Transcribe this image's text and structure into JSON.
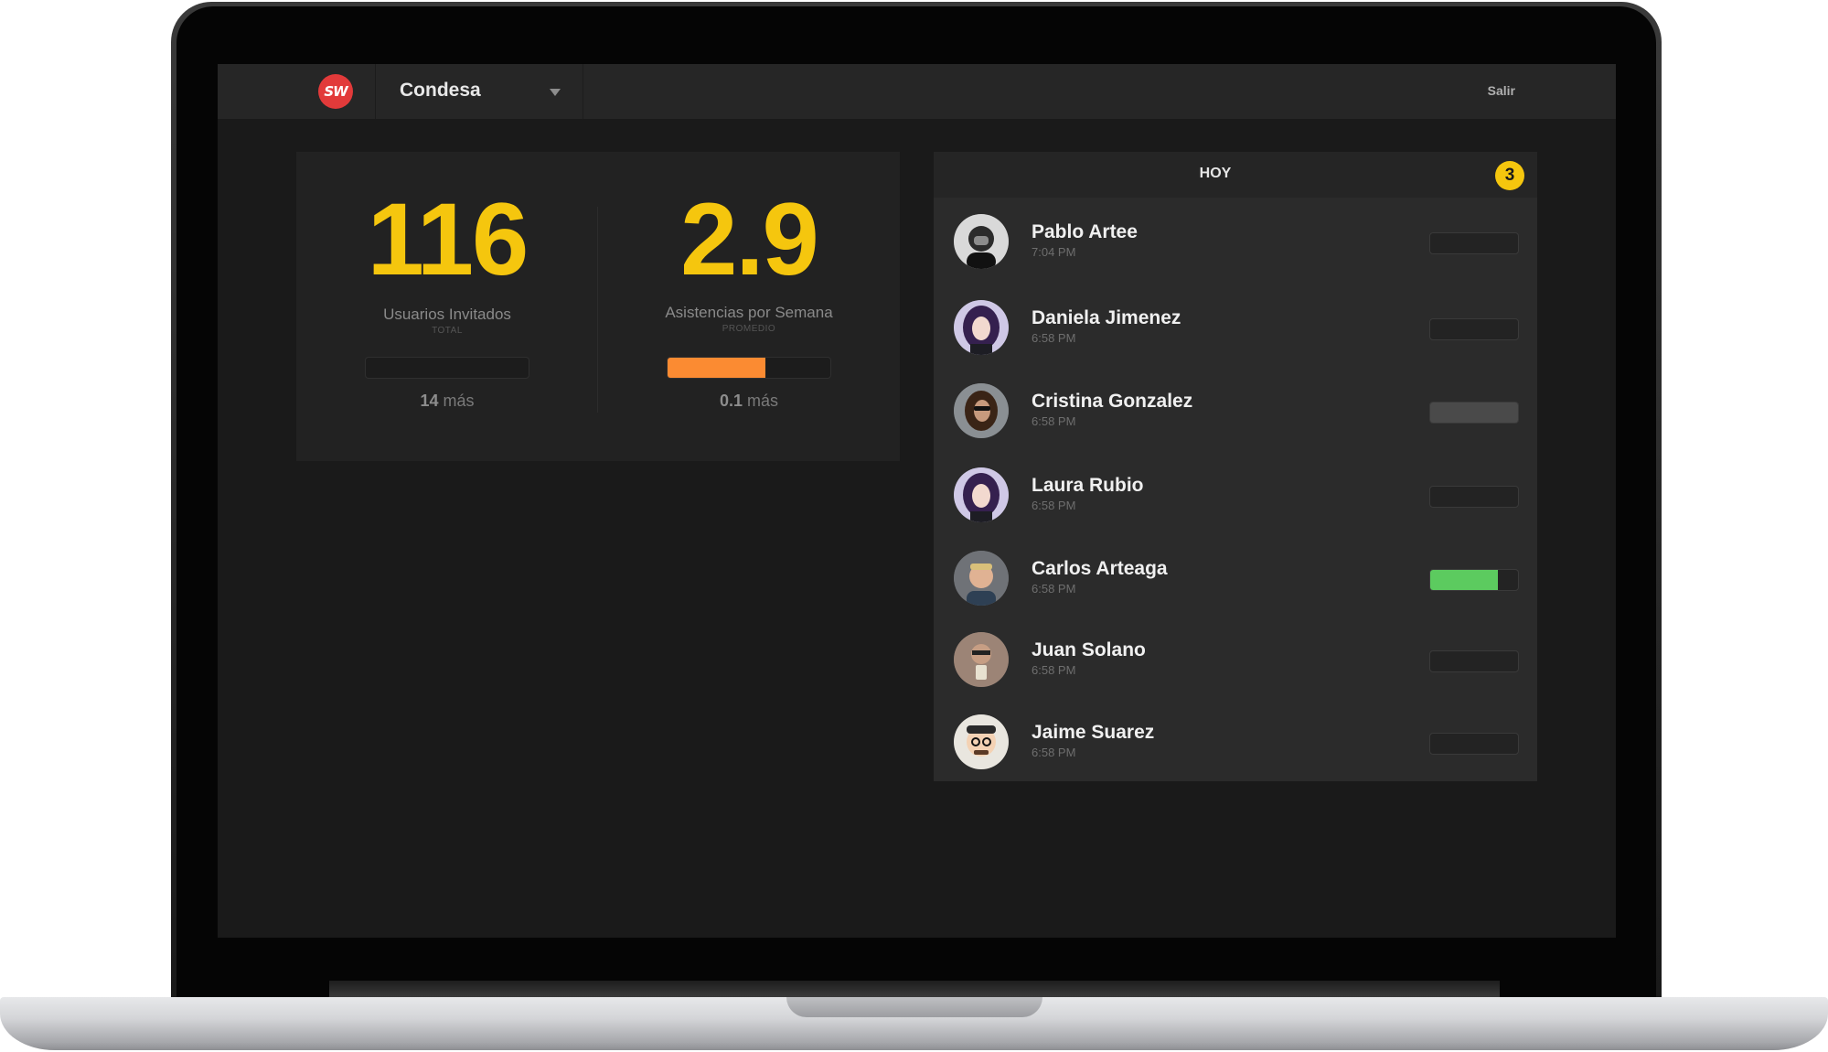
{
  "colors": {
    "accent": "#f5c60e",
    "logo": "#e23a3a",
    "progress_orange": "#fb8b32",
    "progress_green": "#5ccb5f",
    "progress_gray": "#4a4a4a"
  },
  "header": {
    "logo_text": "SW",
    "location": "Condesa",
    "logout_label": "Salir"
  },
  "stats": [
    {
      "value": "116",
      "label": "Usuarios Invitados",
      "sublabel": "TOTAL",
      "progress": 0,
      "more_value": "14",
      "more_label": "más"
    },
    {
      "value": "2.9",
      "label": "Asistencias por Semana",
      "sublabel": "PROMEDIO",
      "progress": 0.6,
      "more_value": "0.1",
      "more_label": "más"
    }
  ],
  "today": {
    "title": "HOY",
    "count": "3",
    "users": [
      {
        "name": "Pablo Artee",
        "time": "7:04 PM",
        "progress": 0,
        "bar_color": "none",
        "avatar": "avatar-bw"
      },
      {
        "name": "Daniela Jimenez",
        "time": "6:58 PM",
        "progress": 0,
        "bar_color": "none",
        "avatar": "avatar-purple"
      },
      {
        "name": "Cristina Gonzalez",
        "time": "6:58 PM",
        "progress": 1,
        "bar_color": "gray",
        "avatar": "avatar-sunglasses"
      },
      {
        "name": "Laura Rubio",
        "time": "6:58 PM",
        "progress": 0,
        "bar_color": "none",
        "avatar": "avatar-purple"
      },
      {
        "name": "Carlos Arteaga",
        "time": "6:58 PM",
        "progress": 0.77,
        "bar_color": "green",
        "avatar": "avatar-blond"
      },
      {
        "name": "Juan Solano",
        "time": "6:58 PM",
        "progress": 0,
        "bar_color": "none",
        "avatar": "avatar-selfie"
      },
      {
        "name": "Jaime Suarez",
        "time": "6:58 PM",
        "progress": 0,
        "bar_color": "none",
        "avatar": "avatar-cartoon"
      }
    ]
  }
}
